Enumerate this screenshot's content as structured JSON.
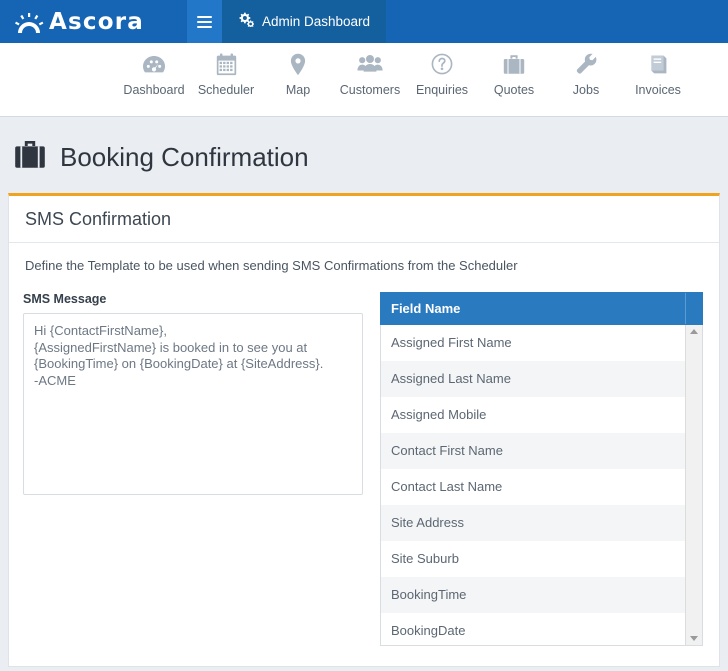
{
  "topbar": {
    "brand": "Ascora",
    "brand_icon": "sunburst-gear-icon",
    "menu_icon": "hamburger-icon",
    "admin_tab": {
      "label": "Admin Dashboard",
      "icon": "cogs-icon"
    }
  },
  "nav": {
    "items": [
      {
        "label": "Dashboard",
        "icon": "dashboard-gauge-icon"
      },
      {
        "label": "Scheduler",
        "icon": "calendar-icon"
      },
      {
        "label": "Map",
        "icon": "map-pin-icon"
      },
      {
        "label": "Customers",
        "icon": "users-icon"
      },
      {
        "label": "Enquiries",
        "icon": "question-circle-icon"
      },
      {
        "label": "Quotes",
        "icon": "briefcase-icon"
      },
      {
        "label": "Jobs",
        "icon": "wrench-icon"
      },
      {
        "label": "Invoices",
        "icon": "book-icon"
      }
    ]
  },
  "page": {
    "title": "Booking Confirmation",
    "title_icon": "briefcase-icon"
  },
  "card": {
    "title": "SMS Confirmation",
    "description": "Define the Template to be used when sending SMS Confirmations from the Scheduler",
    "accent_color": "#f0a31e"
  },
  "form": {
    "sms_message_label": "SMS Message",
    "sms_message_value": "Hi {ContactFirstName},\n{AssignedFirstName} is booked in to see you at\n{BookingTime} on {BookingDate} at {SiteAddress}.\n-ACME",
    "sms_message_placeholder": ""
  },
  "grid": {
    "header": "Field Name",
    "header_color": "#2a7ac0",
    "rows": [
      "Assigned First Name",
      "Assigned Last Name",
      "Assigned Mobile",
      "Contact First Name",
      "Contact Last Name",
      "Site Address",
      "Site Suburb",
      "BookingTime",
      "BookingDate"
    ],
    "scrollbar": {
      "up_icon": "caret-up-icon",
      "down_icon": "caret-down-icon"
    }
  }
}
